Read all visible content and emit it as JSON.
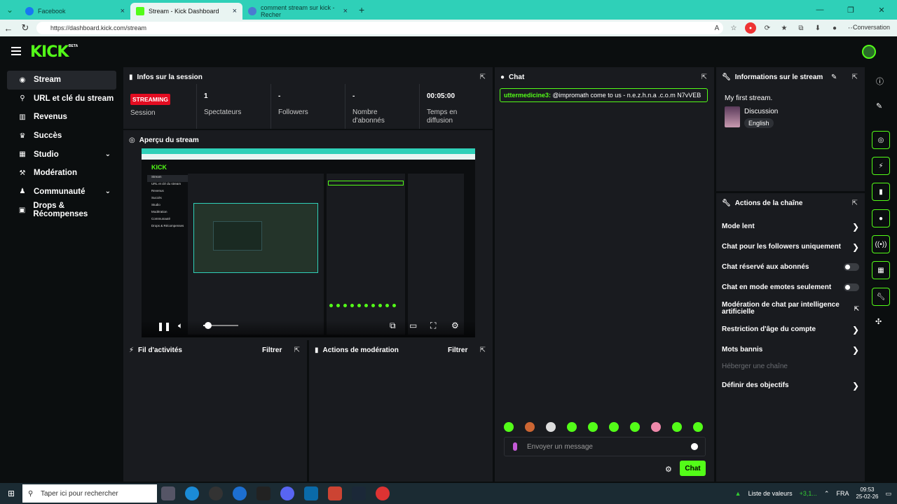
{
  "browser": {
    "tabs": [
      {
        "label": "Facebook",
        "color": "#1877f2"
      },
      {
        "label": "Stream - Kick Dashboard",
        "color": "#53fc18"
      },
      {
        "label": "comment stream sur kick - Recher",
        "color": "#4a7bd1"
      }
    ],
    "url": "https://dashboard.kick.com/stream",
    "conversation": "Conversation"
  },
  "app": {
    "logo": "KICK",
    "beta": "BETA",
    "accent": "#53fc18"
  },
  "sidebar": {
    "items": [
      {
        "label": "Stream",
        "icon": "stream-icon"
      },
      {
        "label": "URL et clé du stream",
        "icon": "link-icon"
      },
      {
        "label": "Revenus",
        "icon": "revenue-icon"
      },
      {
        "label": "Succès",
        "icon": "trophy-icon"
      },
      {
        "label": "Studio",
        "icon": "studio-icon"
      },
      {
        "label": "Modération",
        "icon": "hammer-icon"
      },
      {
        "label": "Communauté",
        "icon": "community-icon"
      },
      {
        "label": "Drops & Récompenses",
        "icon": "gift-icon"
      }
    ]
  },
  "session": {
    "title": "Infos sur la session",
    "status": "STREAMING",
    "status_label": "Session",
    "viewers_value": "1",
    "viewers_label": "Spectateurs",
    "followers_value": "-",
    "followers_label": "Followers",
    "subs_value": "-",
    "subs_label": "Nombre d'abonnés",
    "time_value": "00:05:00",
    "time_label": "Temps en diffusion"
  },
  "preview": {
    "title": "Aperçu du stream",
    "volume_level": 0.1
  },
  "activity": {
    "title": "Fil d'activités",
    "filter": "Filtrer"
  },
  "moderation": {
    "title": "Actions de modération",
    "filter": "Filtrer"
  },
  "chat": {
    "title": "Chat",
    "message_user": "uttermedicine3:",
    "message_text": " @impromath come to us - n.e.z.h.n.a .c.o.m N7vVEB",
    "input_placeholder": "Envoyer un message",
    "send_label": "Chat"
  },
  "stream_info": {
    "title": "Informations sur le stream",
    "stream_title": "My first stream.",
    "category": "Discussion",
    "language": "English"
  },
  "channel_actions": {
    "title": "Actions de la chaîne",
    "items": [
      {
        "label": "Mode lent",
        "control": "arrow"
      },
      {
        "label": "Chat pour les followers uniquement",
        "control": "arrow"
      },
      {
        "label": "Chat réservé aux abonnés",
        "control": "toggle",
        "on": false
      },
      {
        "label": "Chat en mode emotes seulement",
        "control": "toggle",
        "on": false
      },
      {
        "label": "Modération de chat par intelligence artificielle",
        "control": "external"
      },
      {
        "label": "Restriction d'âge du compte",
        "control": "arrow"
      },
      {
        "label": "Mots bannis",
        "control": "arrow"
      },
      {
        "label": "Héberger une chaîne",
        "control": "none",
        "disabled": true
      },
      {
        "label": "Définir des objectifs",
        "control": "arrow"
      }
    ]
  },
  "taskbar": {
    "search_placeholder": "Taper ici pour rechercher",
    "tray_label": "Liste de valeurs",
    "tray_value": "+3,1...",
    "lang": "FRA",
    "time": "09:53",
    "date": "25-02-26"
  }
}
